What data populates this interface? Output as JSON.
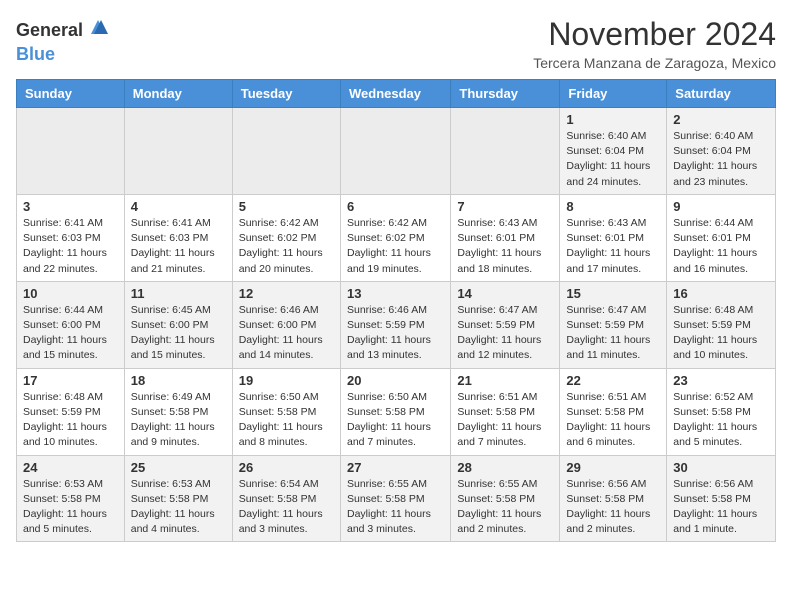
{
  "header": {
    "logo_general": "General",
    "logo_blue": "Blue",
    "month": "November 2024",
    "location": "Tercera Manzana de Zaragoza, Mexico"
  },
  "weekdays": [
    "Sunday",
    "Monday",
    "Tuesday",
    "Wednesday",
    "Thursday",
    "Friday",
    "Saturday"
  ],
  "weeks": [
    [
      {
        "day": "",
        "info": ""
      },
      {
        "day": "",
        "info": ""
      },
      {
        "day": "",
        "info": ""
      },
      {
        "day": "",
        "info": ""
      },
      {
        "day": "",
        "info": ""
      },
      {
        "day": "1",
        "info": "Sunrise: 6:40 AM\nSunset: 6:04 PM\nDaylight: 11 hours and 24 minutes."
      },
      {
        "day": "2",
        "info": "Sunrise: 6:40 AM\nSunset: 6:04 PM\nDaylight: 11 hours and 23 minutes."
      }
    ],
    [
      {
        "day": "3",
        "info": "Sunrise: 6:41 AM\nSunset: 6:03 PM\nDaylight: 11 hours and 22 minutes."
      },
      {
        "day": "4",
        "info": "Sunrise: 6:41 AM\nSunset: 6:03 PM\nDaylight: 11 hours and 21 minutes."
      },
      {
        "day": "5",
        "info": "Sunrise: 6:42 AM\nSunset: 6:02 PM\nDaylight: 11 hours and 20 minutes."
      },
      {
        "day": "6",
        "info": "Sunrise: 6:42 AM\nSunset: 6:02 PM\nDaylight: 11 hours and 19 minutes."
      },
      {
        "day": "7",
        "info": "Sunrise: 6:43 AM\nSunset: 6:01 PM\nDaylight: 11 hours and 18 minutes."
      },
      {
        "day": "8",
        "info": "Sunrise: 6:43 AM\nSunset: 6:01 PM\nDaylight: 11 hours and 17 minutes."
      },
      {
        "day": "9",
        "info": "Sunrise: 6:44 AM\nSunset: 6:01 PM\nDaylight: 11 hours and 16 minutes."
      }
    ],
    [
      {
        "day": "10",
        "info": "Sunrise: 6:44 AM\nSunset: 6:00 PM\nDaylight: 11 hours and 15 minutes."
      },
      {
        "day": "11",
        "info": "Sunrise: 6:45 AM\nSunset: 6:00 PM\nDaylight: 11 hours and 15 minutes."
      },
      {
        "day": "12",
        "info": "Sunrise: 6:46 AM\nSunset: 6:00 PM\nDaylight: 11 hours and 14 minutes."
      },
      {
        "day": "13",
        "info": "Sunrise: 6:46 AM\nSunset: 5:59 PM\nDaylight: 11 hours and 13 minutes."
      },
      {
        "day": "14",
        "info": "Sunrise: 6:47 AM\nSunset: 5:59 PM\nDaylight: 11 hours and 12 minutes."
      },
      {
        "day": "15",
        "info": "Sunrise: 6:47 AM\nSunset: 5:59 PM\nDaylight: 11 hours and 11 minutes."
      },
      {
        "day": "16",
        "info": "Sunrise: 6:48 AM\nSunset: 5:59 PM\nDaylight: 11 hours and 10 minutes."
      }
    ],
    [
      {
        "day": "17",
        "info": "Sunrise: 6:48 AM\nSunset: 5:59 PM\nDaylight: 11 hours and 10 minutes."
      },
      {
        "day": "18",
        "info": "Sunrise: 6:49 AM\nSunset: 5:58 PM\nDaylight: 11 hours and 9 minutes."
      },
      {
        "day": "19",
        "info": "Sunrise: 6:50 AM\nSunset: 5:58 PM\nDaylight: 11 hours and 8 minutes."
      },
      {
        "day": "20",
        "info": "Sunrise: 6:50 AM\nSunset: 5:58 PM\nDaylight: 11 hours and 7 minutes."
      },
      {
        "day": "21",
        "info": "Sunrise: 6:51 AM\nSunset: 5:58 PM\nDaylight: 11 hours and 7 minutes."
      },
      {
        "day": "22",
        "info": "Sunrise: 6:51 AM\nSunset: 5:58 PM\nDaylight: 11 hours and 6 minutes."
      },
      {
        "day": "23",
        "info": "Sunrise: 6:52 AM\nSunset: 5:58 PM\nDaylight: 11 hours and 5 minutes."
      }
    ],
    [
      {
        "day": "24",
        "info": "Sunrise: 6:53 AM\nSunset: 5:58 PM\nDaylight: 11 hours and 5 minutes."
      },
      {
        "day": "25",
        "info": "Sunrise: 6:53 AM\nSunset: 5:58 PM\nDaylight: 11 hours and 4 minutes."
      },
      {
        "day": "26",
        "info": "Sunrise: 6:54 AM\nSunset: 5:58 PM\nDaylight: 11 hours and 3 minutes."
      },
      {
        "day": "27",
        "info": "Sunrise: 6:55 AM\nSunset: 5:58 PM\nDaylight: 11 hours and 3 minutes."
      },
      {
        "day": "28",
        "info": "Sunrise: 6:55 AM\nSunset: 5:58 PM\nDaylight: 11 hours and 2 minutes."
      },
      {
        "day": "29",
        "info": "Sunrise: 6:56 AM\nSunset: 5:58 PM\nDaylight: 11 hours and 2 minutes."
      },
      {
        "day": "30",
        "info": "Sunrise: 6:56 AM\nSunset: 5:58 PM\nDaylight: 11 hours and 1 minute."
      }
    ]
  ]
}
